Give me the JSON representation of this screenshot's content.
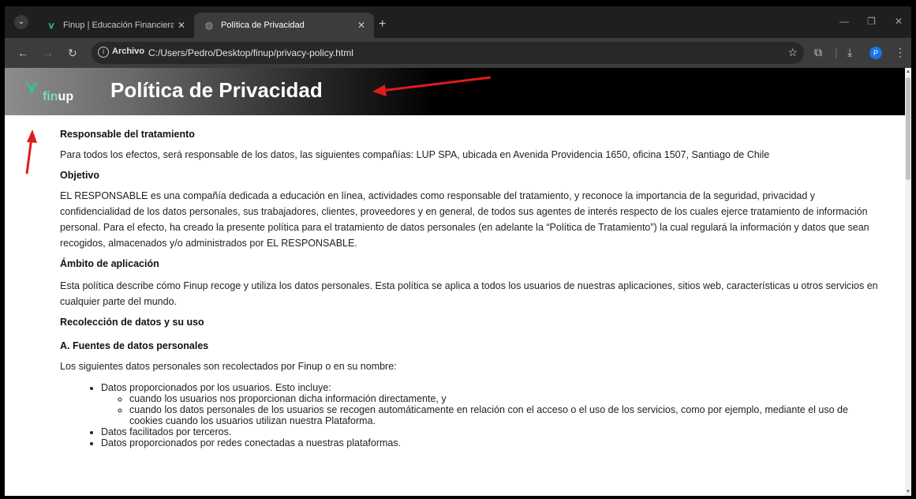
{
  "browser": {
    "tabs": [
      {
        "label": "Finup | Educación Financiera",
        "active": false,
        "favicon": "finup-icon"
      },
      {
        "label": "Política de Privacidad",
        "active": true,
        "favicon": "globe-icon"
      }
    ],
    "address": {
      "chip": "Archivo",
      "url": "C:/Users/Pedro/Desktop/finup/privacy-policy.html"
    },
    "profile_initial": "P"
  },
  "page": {
    "logo_text": {
      "fin": "fin",
      "up": "up"
    },
    "title": "Política de Privacidad",
    "sections": {
      "responsable_heading": "Responsable del tratamiento",
      "responsable_text": "Para todos los efectos, será responsable de los datos, las siguientes compañías: LUP SPA, ubicada en Avenida Providencia 1650, oficina 1507, Santiago de Chile",
      "objetivo_heading": "Objetivo",
      "objetivo_text": "EL RESPONSABLE es una compañía dedicada a educación en línea, actividades como responsable del tratamiento, y reconoce la importancia de la seguridad, privacidad y confidencialidad de los datos personales, sus trabajadores, clientes, proveedores y en general, de todos sus agentes de interés respecto de los cuales ejerce tratamiento de información personal. Para el efecto, ha creado la presente política para el tratamiento de datos personales (en adelante la “Política de Tratamiento”) la cual regulará la información y datos que sean recogidos, almacenados y/o administrados por EL RESPONSABLE.",
      "ambito_heading": "Ámbito de aplicación",
      "ambito_text": "Esta política describe cómo Finup recoge y utiliza los datos personales. Esta política se aplica a todos los usuarios de nuestras aplicaciones, sitios web, características u otros servicios en cualquier parte del mundo.",
      "recoleccion_heading": "Recolección de datos y su uso",
      "fuentes_heading": "A. Fuentes de datos personales",
      "fuentes_text": "Los siguientes datos personales son recolectados por Finup o en su nombre:",
      "list": {
        "item1": "Datos proporcionados por los usuarios. Esto incluye:",
        "sub1": "cuando los usuarios nos proporcionan dicha información directamente, y",
        "sub2": "cuando los datos personales de los usuarios se recogen automáticamente en relación con el acceso o el uso de los servicios, como por ejemplo, mediante el uso de cookies cuando los usuarios utilizan nuestra Plataforma.",
        "item2": "Datos facilitados por terceros.",
        "item3": "Datos proporcionados por redes conectadas a nuestras plataformas."
      }
    }
  },
  "colors": {
    "annotation_arrow": "#e01b1b",
    "brand": "#2ec4a0"
  }
}
